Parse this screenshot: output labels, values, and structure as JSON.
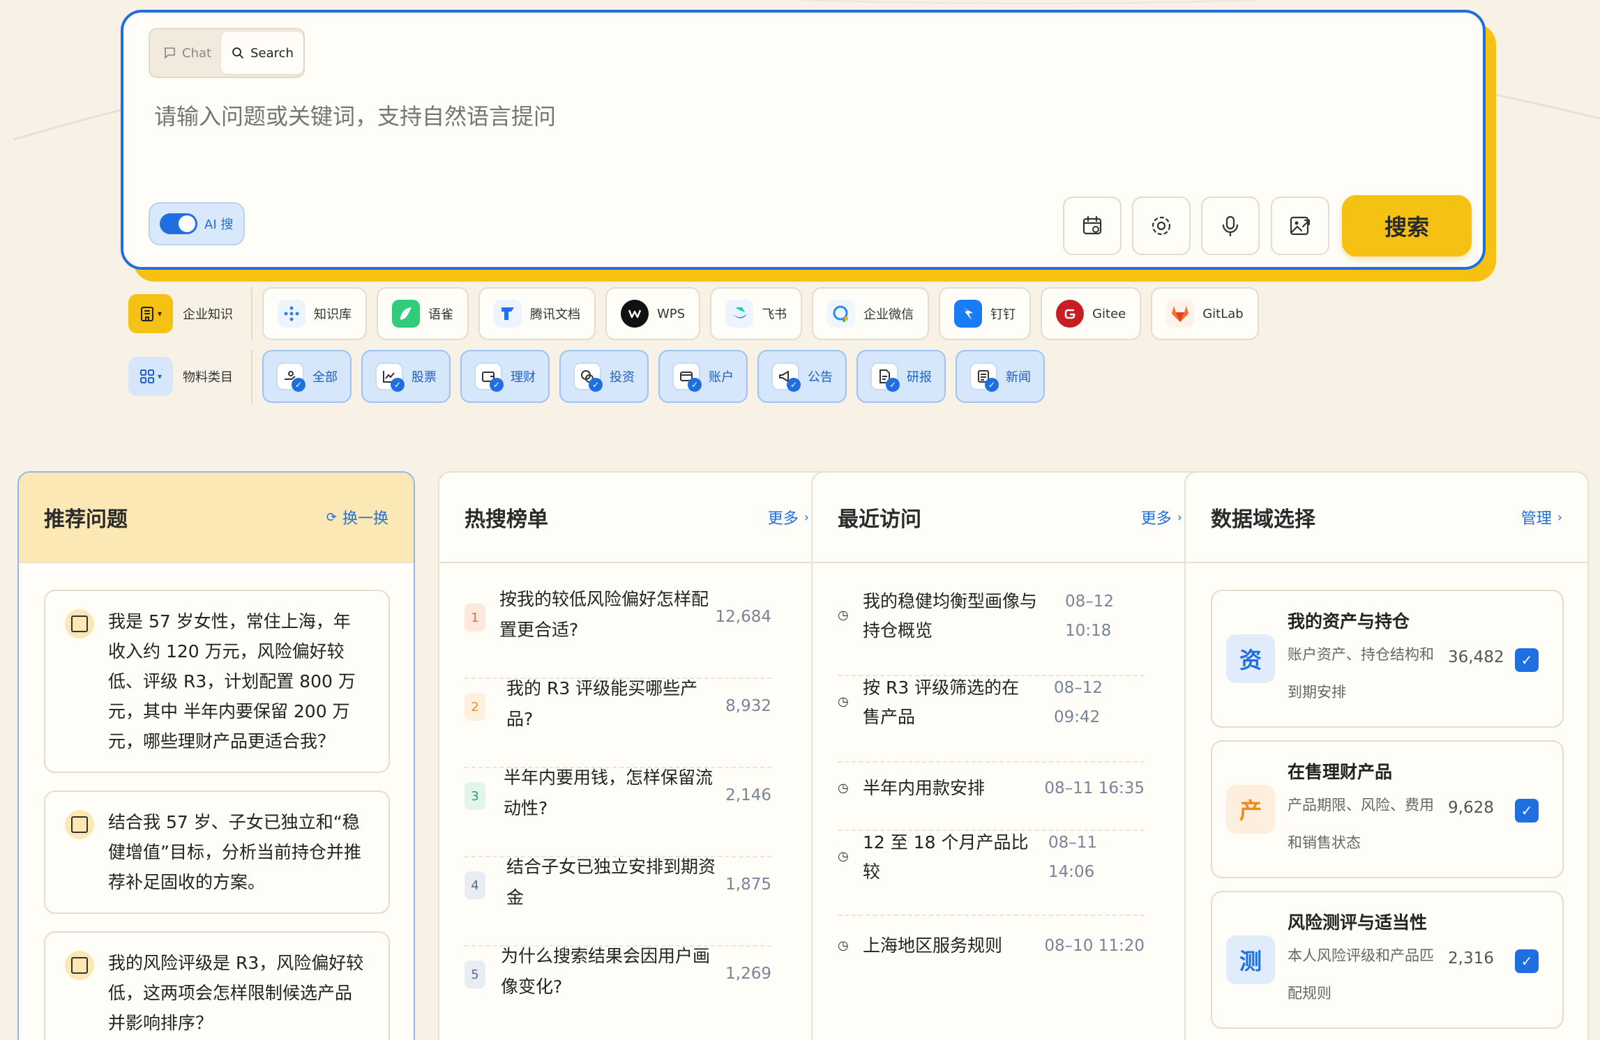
{
  "search": {
    "tabs": [
      {
        "label": "Chat",
        "icon": "chat-icon"
      },
      {
        "label": "Search",
        "icon": "search-icon"
      }
    ],
    "placeholder": "请输入问题或关键词，支持自然语言提问",
    "ai_toggle_label": "AI 搜",
    "ai_toggle_on": true,
    "tools": [
      "calendar-icon",
      "settings-icon",
      "microphone-icon",
      "image-upload-icon"
    ],
    "submit_label": "搜索"
  },
  "sources": {
    "title": "企业知识",
    "items": [
      {
        "label": "知识库",
        "color": "#2f80ed"
      },
      {
        "label": "语雀",
        "color": "#31cc79"
      },
      {
        "label": "腾讯文档",
        "color": "#1e6fff"
      },
      {
        "label": "WPS",
        "color": "#111111"
      },
      {
        "label": "飞书",
        "color": "#3370ff"
      },
      {
        "label": "企业微信",
        "color": "#2a8cf0"
      },
      {
        "label": "钉钉",
        "color": "#1a7cf5"
      },
      {
        "label": "Gitee",
        "color": "#c71d23"
      },
      {
        "label": "GitLab",
        "color": "#fc6d26"
      }
    ]
  },
  "categories": {
    "title": "物料类目",
    "items": [
      "全部",
      "股票",
      "理财",
      "投资",
      "账户",
      "公告",
      "研报",
      "新闻"
    ]
  },
  "recommend": {
    "title": "推荐问题",
    "action": "换一换",
    "items": [
      "我是 57 岁女性，常住上海，年收入约 120 万元，风险偏好较低、评级 R3，计划配置 800 万元，其中 半年内要保留 200 万元，哪些理财产品更适合我？",
      "结合我 57 岁、子女已独立和“稳健增值”目标，分析当前持仓并推荐补足固收的方案。",
      "我的风险评级是 R3，风险偏好较低，这两项会怎样限制候选产品并影响排序？"
    ]
  },
  "hot": {
    "title": "热搜榜单",
    "more": "更多",
    "items": [
      {
        "rank": "1",
        "text": "按我的较低风险偏好怎样配置更合适?",
        "count": "12,684"
      },
      {
        "rank": "2",
        "text": "我的 R3 评级能买哪些产品?",
        "count": "8,932"
      },
      {
        "rank": "3",
        "text": "半年内要用钱，怎样保留流动性?",
        "count": "2,146"
      },
      {
        "rank": "4",
        "text": "结合子女已独立安排到期资金",
        "count": "1,875"
      },
      {
        "rank": "5",
        "text": "为什么搜索结果会因用户画像变化?",
        "count": "1,269"
      }
    ]
  },
  "recent": {
    "title": "最近访问",
    "more": "更多",
    "items": [
      {
        "text_lines": [
          "我的稳健均衡型画像与",
          "持仓概览"
        ],
        "time_lines": [
          "08–12",
          "10:18"
        ]
      },
      {
        "text_lines": [
          "按 R3 评级筛选的在",
          "售产品"
        ],
        "time_lines": [
          "08–12",
          "09:42"
        ]
      },
      {
        "text_lines": [
          "半年内用款安排"
        ],
        "time_lines": [
          "08–11 16:35"
        ]
      },
      {
        "text_lines": [
          "12 至 18 个月产品比",
          "较"
        ],
        "time_lines": [
          "08–11",
          "14:06"
        ]
      },
      {
        "text_lines": [
          "上海地区服务规则"
        ],
        "time_lines": [
          "08–10 11:20"
        ]
      }
    ]
  },
  "domains": {
    "title": "数据域选择",
    "manage": "管理",
    "items": [
      {
        "badge": "资",
        "name": "我的资产与持仓",
        "desc": "账户资产、持仓结构和到期安排",
        "count": "36,482",
        "checked": true,
        "badge_color": "#1f6fe0",
        "badge_bg": "#e1ecfb"
      },
      {
        "badge": "产",
        "name": "在售理财产品",
        "desc": "产品期限、风险、费用和销售状态",
        "count": "9,628",
        "checked": true,
        "badge_color": "#f08a1c",
        "badge_bg": "#fdeedd"
      },
      {
        "badge": "测",
        "name": "风险测评与适当性",
        "desc": "本人风险评级和产品匹配规则",
        "count": "2,316",
        "checked": true,
        "badge_color": "#1f6fe0",
        "badge_bg": "#e1ecfb"
      }
    ]
  }
}
